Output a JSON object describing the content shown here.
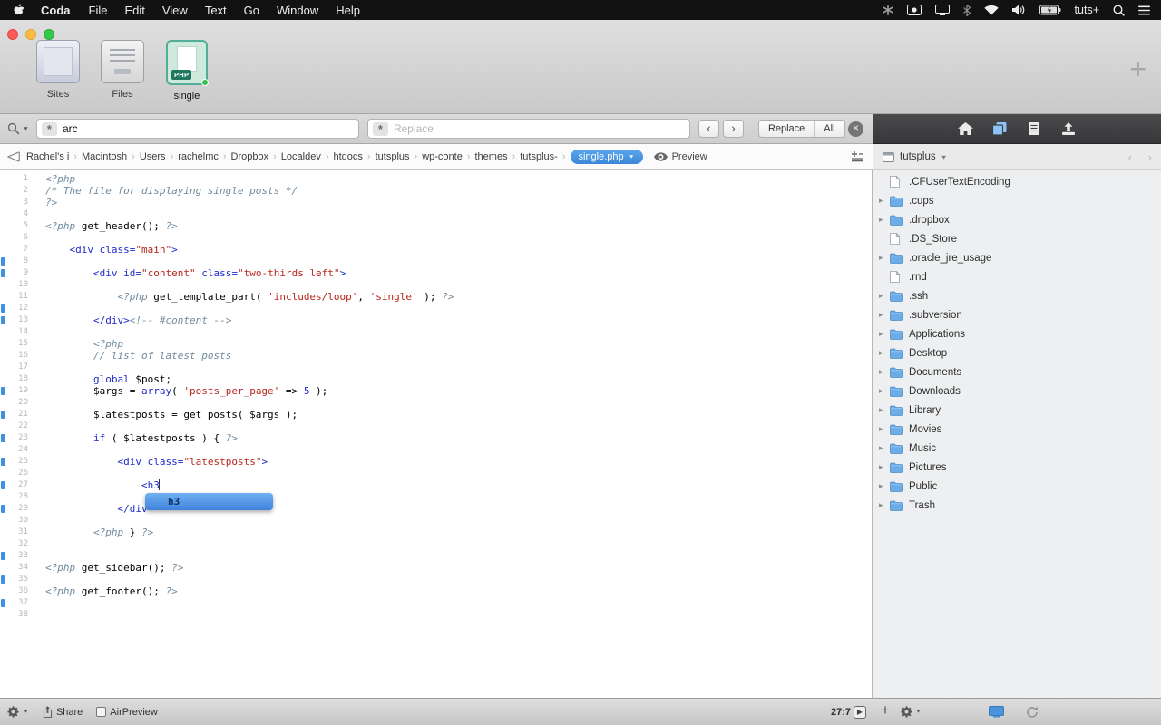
{
  "menubar": {
    "app_name": "Coda",
    "menus": [
      "File",
      "Edit",
      "View",
      "Text",
      "Go",
      "Window",
      "Help"
    ],
    "username": "tuts+",
    "status_icons": [
      "keyboard-maestro",
      "screen-recording",
      "display",
      "bluetooth",
      "wifi",
      "volume",
      "battery-charging",
      "spotlight",
      "notification-center"
    ]
  },
  "toolbar": {
    "tabs": [
      {
        "label": "Sites"
      },
      {
        "label": "Files"
      },
      {
        "label": "single",
        "badge": "PHP",
        "selected": true
      }
    ],
    "add_label": "+"
  },
  "findbar": {
    "search_value": "arc",
    "replace_placeholder": "Replace",
    "replace_button": "Replace",
    "all_button": "All"
  },
  "pathbar": {
    "crumbs": [
      "Rachel's i",
      "Macintosh",
      "Users",
      "rachelmc",
      "Dropbox",
      "Localdev",
      "htdocs",
      "tutsplus",
      "wp-conte",
      "themes",
      "tutsplus-"
    ],
    "current_file": "single.php",
    "preview_label": "Preview"
  },
  "editor": {
    "line_count": 38,
    "changed_lines": [
      8,
      9,
      12,
      13,
      19,
      21,
      23,
      25,
      27,
      29,
      33,
      35,
      37
    ],
    "lines": [
      [
        [
          "<?php",
          "php"
        ]
      ],
      [
        [
          "/* The file for displaying single posts */",
          "cmt"
        ]
      ],
      [
        [
          "?>",
          "php"
        ]
      ],
      [],
      [
        [
          "<?php ",
          "php"
        ],
        [
          "get_header();",
          "pln"
        ],
        [
          " ",
          "pln"
        ],
        [
          "?>",
          "php"
        ]
      ],
      [],
      [
        [
          "    ",
          "pln"
        ],
        [
          "<div ",
          "tag"
        ],
        [
          "class=",
          "attr"
        ],
        [
          "\"main\"",
          "str"
        ],
        [
          ">",
          "tag"
        ]
      ],
      [],
      [
        [
          "        ",
          "pln"
        ],
        [
          "<div ",
          "tag"
        ],
        [
          "id=",
          "attr"
        ],
        [
          "\"content\"",
          "str"
        ],
        [
          " ",
          "pln"
        ],
        [
          "class=",
          "attr"
        ],
        [
          "\"two-thirds left\"",
          "str"
        ],
        [
          ">",
          "tag"
        ]
      ],
      [],
      [
        [
          "            ",
          "pln"
        ],
        [
          "<?php ",
          "php"
        ],
        [
          "get_template_part( ",
          "pln"
        ],
        [
          "'includes/loop'",
          "str"
        ],
        [
          ", ",
          "pln"
        ],
        [
          "'single'",
          "str"
        ],
        [
          " ); ",
          "pln"
        ],
        [
          "?>",
          "php"
        ]
      ],
      [],
      [
        [
          "        ",
          "pln"
        ],
        [
          "</div>",
          "tag"
        ],
        [
          "<!-- #content -->",
          "cmt"
        ]
      ],
      [],
      [
        [
          "        ",
          "pln"
        ],
        [
          "<?php",
          "php"
        ]
      ],
      [
        [
          "        ",
          "pln"
        ],
        [
          "// list of latest posts",
          "cmt"
        ]
      ],
      [],
      [
        [
          "        ",
          "pln"
        ],
        [
          "global ",
          "kw"
        ],
        [
          "$post;",
          "pln"
        ]
      ],
      [
        [
          "        ",
          "pln"
        ],
        [
          "$args = ",
          "pln"
        ],
        [
          "array",
          "kw"
        ],
        [
          "( ",
          "pln"
        ],
        [
          "'posts_per_page'",
          "str"
        ],
        [
          " => ",
          "pln"
        ],
        [
          "5",
          "num"
        ],
        [
          " );",
          "pln"
        ]
      ],
      [],
      [
        [
          "        ",
          "pln"
        ],
        [
          "$latestposts = get_posts( $args );",
          "pln"
        ]
      ],
      [],
      [
        [
          "        ",
          "pln"
        ],
        [
          "if",
          "kw"
        ],
        [
          " ( $latestposts ) { ",
          "pln"
        ],
        [
          "?>",
          "php"
        ]
      ],
      [],
      [
        [
          "            ",
          "pln"
        ],
        [
          "<div ",
          "tag"
        ],
        [
          "class=",
          "attr"
        ],
        [
          "\"latestposts\"",
          "str"
        ],
        [
          ">",
          "tag"
        ]
      ],
      [],
      [
        [
          "                ",
          "pln"
        ],
        [
          "<h3",
          "tag"
        ]
      ],
      [],
      [
        [
          "            ",
          "pln"
        ],
        [
          "</div",
          "tag"
        ]
      ],
      [],
      [
        [
          "        ",
          "pln"
        ],
        [
          "<?php ",
          "php"
        ],
        [
          "} ",
          "pln"
        ],
        [
          "?>",
          "php"
        ]
      ],
      [],
      [],
      [
        [
          "<?php ",
          "php"
        ],
        [
          "get_sidebar();",
          "pln"
        ],
        [
          " ",
          "pln"
        ],
        [
          "?>",
          "php"
        ]
      ],
      [],
      [
        [
          "<?php ",
          "php"
        ],
        [
          "get_footer();",
          "pln"
        ],
        [
          " ",
          "pln"
        ],
        [
          "?>",
          "php"
        ]
      ],
      [],
      []
    ]
  },
  "autocomplete": {
    "selected": "h3"
  },
  "sidebar": {
    "source_name": "tutsplus",
    "files": [
      {
        "name": ".CFUserTextEncoding",
        "kind": "file"
      },
      {
        "name": ".cups",
        "kind": "folder"
      },
      {
        "name": ".dropbox",
        "kind": "folder"
      },
      {
        "name": ".DS_Store",
        "kind": "file"
      },
      {
        "name": ".oracle_jre_usage",
        "kind": "folder"
      },
      {
        "name": ".rnd",
        "kind": "file"
      },
      {
        "name": ".ssh",
        "kind": "folder"
      },
      {
        "name": ".subversion",
        "kind": "folder"
      },
      {
        "name": "Applications",
        "kind": "folder"
      },
      {
        "name": "Desktop",
        "kind": "folder"
      },
      {
        "name": "Documents",
        "kind": "folder"
      },
      {
        "name": "Downloads",
        "kind": "folder"
      },
      {
        "name": "Library",
        "kind": "folder"
      },
      {
        "name": "Movies",
        "kind": "folder"
      },
      {
        "name": "Music",
        "kind": "folder"
      },
      {
        "name": "Pictures",
        "kind": "folder"
      },
      {
        "name": "Public",
        "kind": "folder"
      },
      {
        "name": "Trash",
        "kind": "folder"
      }
    ]
  },
  "statusbar": {
    "share_label": "Share",
    "airpreview_label": "AirPreview",
    "cursor_position": "27:7"
  }
}
